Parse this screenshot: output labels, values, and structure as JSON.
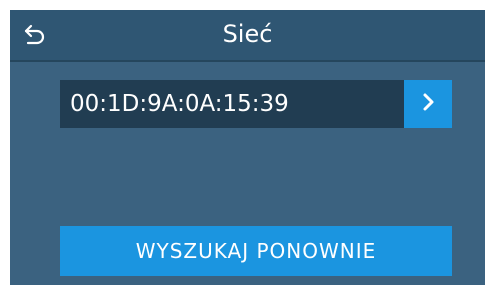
{
  "header": {
    "title": "Sieć",
    "back_icon": "back-arrow-icon"
  },
  "networks": [
    {
      "label": "00:1D:9A:0A:15:39",
      "action_icon": "chevron-right-icon"
    }
  ],
  "footer": {
    "rescan_label": "WYSZUKAJ PONOWNIE"
  },
  "colors": {
    "screen_bg": "#3b6280",
    "header_bg": "#2f5673",
    "row_bg": "#213d52",
    "accent": "#1b95e0",
    "text": "#ffffff"
  }
}
